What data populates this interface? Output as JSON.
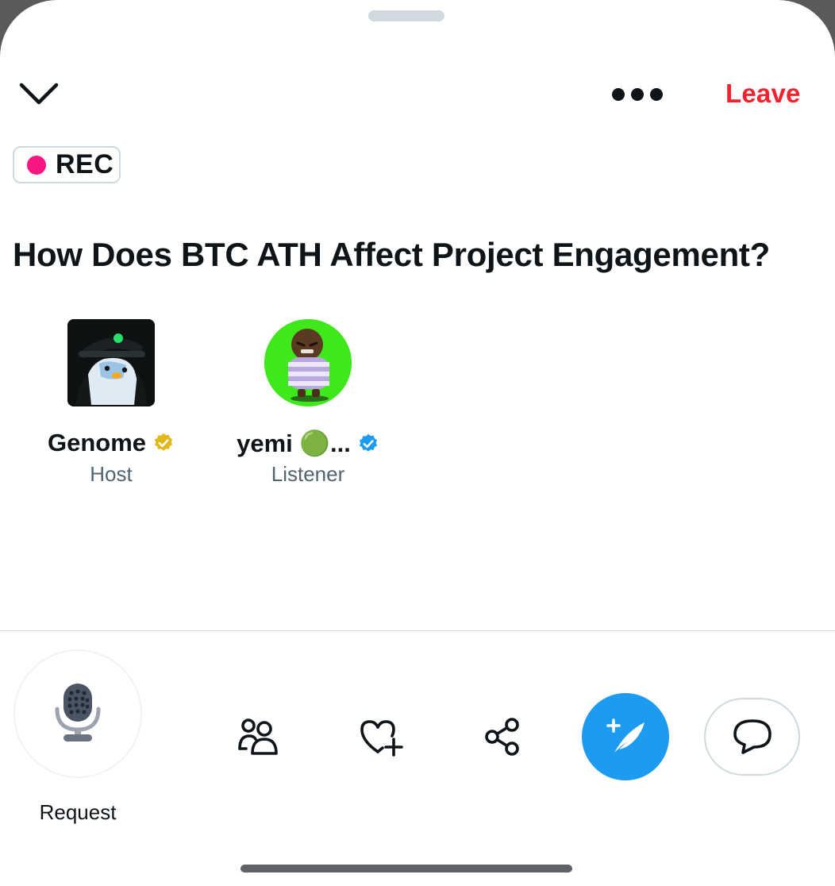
{
  "header": {
    "collapse_icon": "chevron-down-icon",
    "more_icon": "more-dots-icon",
    "leave_label": "Leave",
    "leave_color": "#f4212e"
  },
  "recording": {
    "label": "REC",
    "dot_color": "#f91880"
  },
  "space": {
    "title": "How Does BTC ATH Affect Project Engagement?"
  },
  "participants": [
    {
      "name": "Genome",
      "role": "Host",
      "badge": "gold-verified-badge-icon"
    },
    {
      "name": "yemi 🟢...",
      "role": "Listener",
      "badge": "blue-verified-badge-icon"
    }
  ],
  "controls": {
    "mic_label": "Request",
    "mic_icon": "microphone-icon",
    "people_icon": "people-icon",
    "reaction_icon": "heart-plus-icon",
    "share_icon": "share-icon",
    "compose_icon": "compose-post-icon",
    "comment_icon": "comment-bubble-icon",
    "accent": "#1d9bf0"
  }
}
